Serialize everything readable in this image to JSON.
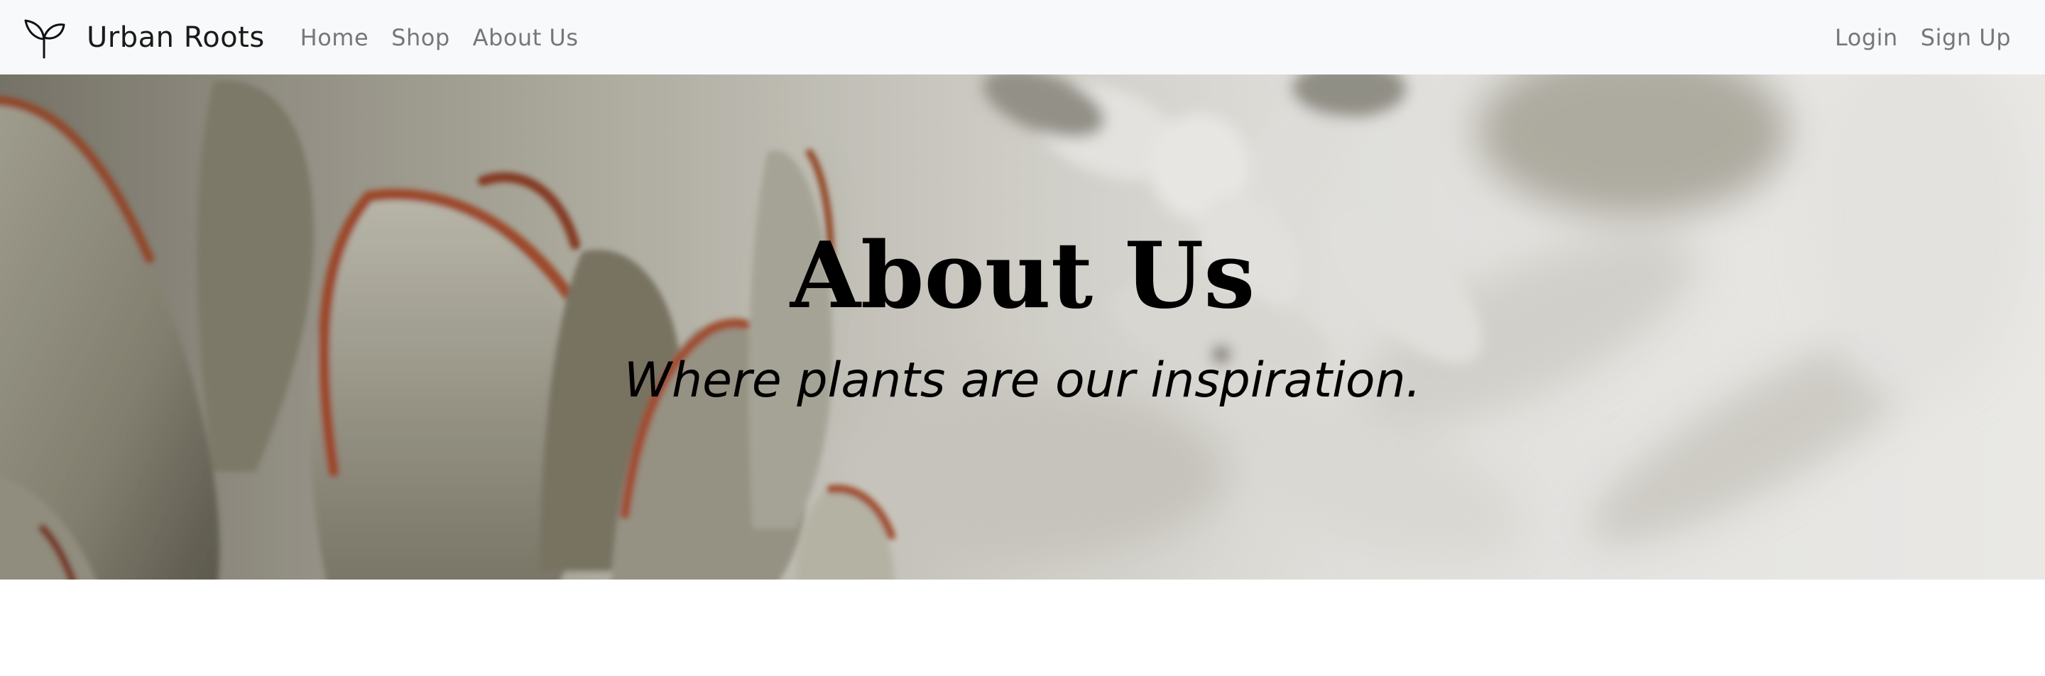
{
  "navbar": {
    "brand_icon": "sprout-icon",
    "brand_name": "Urban Roots",
    "links": [
      {
        "label": "Home"
      },
      {
        "label": "Shop"
      },
      {
        "label": "About Us"
      }
    ],
    "auth": {
      "login": "Login",
      "signup": "Sign Up"
    },
    "background": "#f8f9fa",
    "link_color": "#777777"
  },
  "hero": {
    "image": "succulent-plant-photo",
    "title": "About Us",
    "subtitle": "Where plants are our inspiration."
  }
}
